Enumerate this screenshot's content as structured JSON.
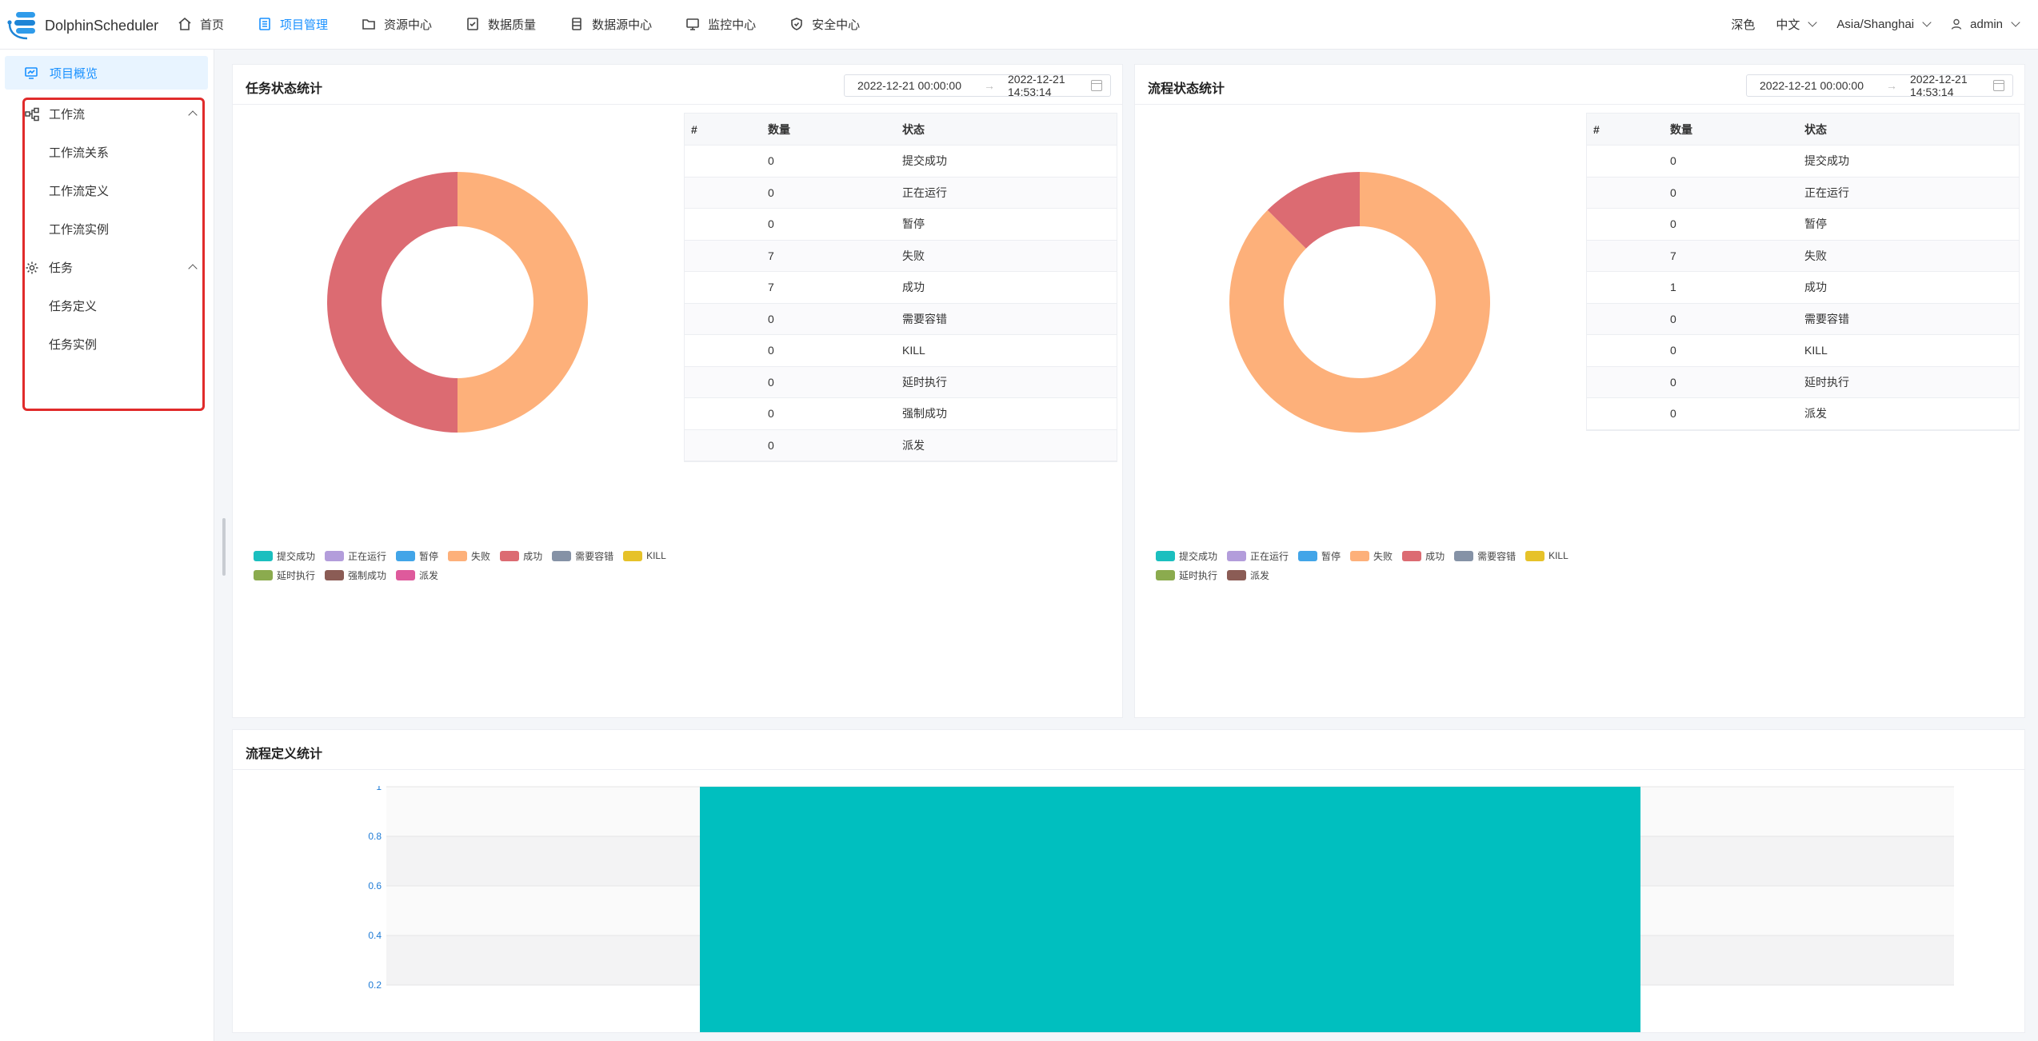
{
  "app": {
    "name": "DolphinScheduler"
  },
  "nav": [
    {
      "label": "首页",
      "icon": "home-icon",
      "active": false
    },
    {
      "label": "项目管理",
      "icon": "project-icon",
      "active": true
    },
    {
      "label": "资源中心",
      "icon": "folder-icon",
      "active": false
    },
    {
      "label": "数据质量",
      "icon": "data-quality-icon",
      "active": false
    },
    {
      "label": "数据源中心",
      "icon": "datasource-icon",
      "active": false
    },
    {
      "label": "监控中心",
      "icon": "monitor-icon",
      "active": false
    },
    {
      "label": "安全中心",
      "icon": "shield-icon",
      "active": false
    }
  ],
  "header_right": {
    "theme": "深色",
    "language": "中文",
    "timezone": "Asia/Shanghai",
    "user": "admin"
  },
  "sidebar": {
    "overview": "项目概览",
    "workflow": {
      "label": "工作流",
      "items": [
        "工作流关系",
        "工作流定义",
        "工作流实例"
      ]
    },
    "task": {
      "label": "任务",
      "items": [
        "任务定义",
        "任务实例"
      ]
    }
  },
  "task_status": {
    "title": "任务状态统计",
    "start": "2022-12-21 00:00:00",
    "end": "2022-12-21 14:53:14",
    "headers": [
      "#",
      "数量",
      "状态"
    ],
    "rows": [
      {
        "count": "0",
        "state": "提交成功"
      },
      {
        "count": "0",
        "state": "正在运行"
      },
      {
        "count": "0",
        "state": "暂停"
      },
      {
        "count": "7",
        "state": "失败"
      },
      {
        "count": "7",
        "state": "成功"
      },
      {
        "count": "0",
        "state": "需要容错"
      },
      {
        "count": "0",
        "state": "KILL"
      },
      {
        "count": "0",
        "state": "延时执行"
      },
      {
        "count": "0",
        "state": "强制成功"
      },
      {
        "count": "0",
        "state": "派发"
      }
    ],
    "legend": [
      {
        "label": "提交成功",
        "color": "#1bbfbf"
      },
      {
        "label": "正在运行",
        "color": "#b39ddb"
      },
      {
        "label": "暂停",
        "color": "#42a5e8"
      },
      {
        "label": "失败",
        "color": "#fdb07a"
      },
      {
        "label": "成功",
        "color": "#dc6b72"
      },
      {
        "label": "需要容错",
        "color": "#8592a6"
      },
      {
        "label": "KILL",
        "color": "#e6c229"
      },
      {
        "label": "延时执行",
        "color": "#8bab4e"
      },
      {
        "label": "强制成功",
        "color": "#8b5c55"
      },
      {
        "label": "派发",
        "color": "#de5a9c"
      }
    ]
  },
  "process_status": {
    "title": "流程状态统计",
    "start": "2022-12-21 00:00:00",
    "end": "2022-12-21 14:53:14",
    "headers": [
      "#",
      "数量",
      "状态"
    ],
    "rows": [
      {
        "count": "0",
        "state": "提交成功"
      },
      {
        "count": "0",
        "state": "正在运行"
      },
      {
        "count": "0",
        "state": "暂停"
      },
      {
        "count": "7",
        "state": "失败"
      },
      {
        "count": "1",
        "state": "成功"
      },
      {
        "count": "0",
        "state": "需要容错"
      },
      {
        "count": "0",
        "state": "KILL"
      },
      {
        "count": "0",
        "state": "延时执行"
      },
      {
        "count": "0",
        "state": "派发"
      }
    ],
    "legend": [
      {
        "label": "提交成功",
        "color": "#1bbfbf"
      },
      {
        "label": "正在运行",
        "color": "#b39ddb"
      },
      {
        "label": "暂停",
        "color": "#42a5e8"
      },
      {
        "label": "失败",
        "color": "#fdb07a"
      },
      {
        "label": "成功",
        "color": "#dc6b72"
      },
      {
        "label": "需要容错",
        "color": "#8592a6"
      },
      {
        "label": "KILL",
        "color": "#e6c229"
      },
      {
        "label": "延时执行",
        "color": "#8bab4e"
      },
      {
        "label": "派发",
        "color": "#8b5c55"
      }
    ]
  },
  "process_definition": {
    "title": "流程定义统计"
  },
  "chart_data": [
    {
      "type": "pie",
      "categories": [
        "失败",
        "成功"
      ],
      "values": [
        7,
        7
      ],
      "colors": [
        "#fdb07a",
        "#dc6b72"
      ]
    },
    {
      "type": "pie",
      "categories": [
        "失败",
        "成功"
      ],
      "values": [
        7,
        1
      ],
      "colors": [
        "#fdb07a",
        "#dc6b72"
      ]
    },
    {
      "type": "bar",
      "categories": [
        ""
      ],
      "values": [
        1
      ],
      "color": "#00bfbf",
      "ylim": [
        0,
        1
      ],
      "yticks": [
        "1",
        "0.8",
        "0.6",
        "0.4",
        "0.2"
      ]
    }
  ]
}
